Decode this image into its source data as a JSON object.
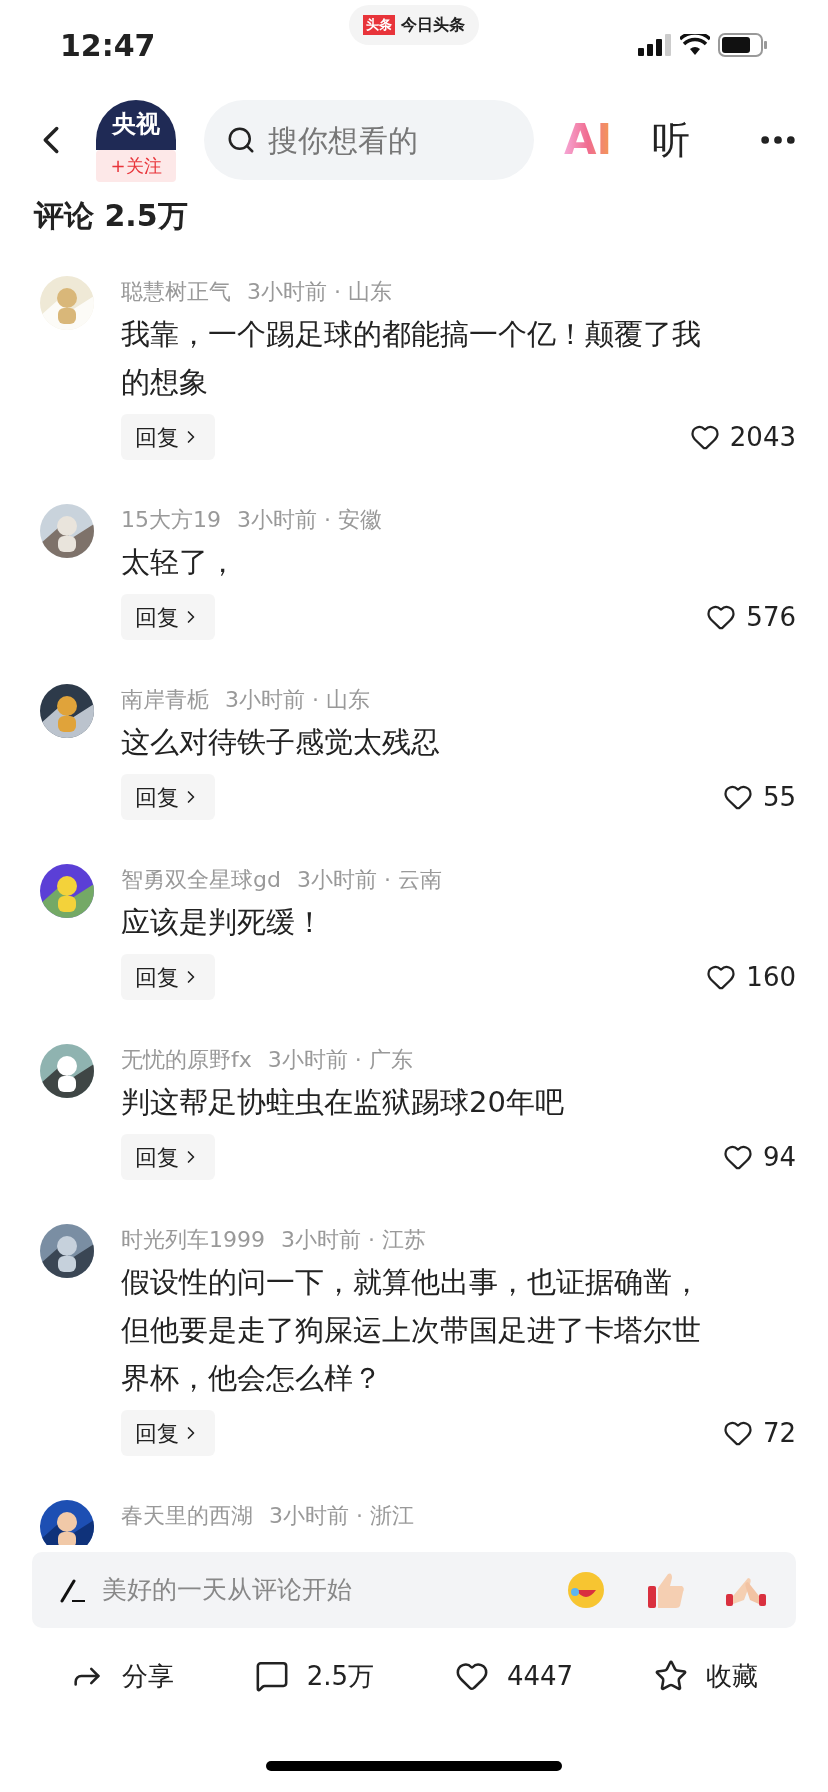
{
  "status_bar": {
    "time": "12:47",
    "app_badge": {
      "logo_text": "头条",
      "label": "今日头条"
    }
  },
  "header": {
    "channel": {
      "avatar_text": "央视",
      "follow_label": "+关注"
    },
    "search": {
      "placeholder": "搜你想看的"
    },
    "ai_label": "AI",
    "listen_label": "听"
  },
  "comments_title": "评论 2.5万",
  "comments": [
    {
      "user": "聪慧树正气",
      "meta": "3小时前 · 山东",
      "text": "我靠，一个踢足球的都能搞一个亿！颠覆了我的想象",
      "reply_label": "回复",
      "likes": "2043"
    },
    {
      "user": "15大方19",
      "meta": "3小时前 · 安徽",
      "text": "太轻了，",
      "reply_label": "回复",
      "likes": "576"
    },
    {
      "user": "南岸青栀",
      "meta": "3小时前 · 山东",
      "text": "这么对待铁子感觉太残忍",
      "reply_label": "回复",
      "likes": "55"
    },
    {
      "user": "智勇双全星球gd",
      "meta": "3小时前 · 云南",
      "text": "应该是判死缓！",
      "reply_label": "回复",
      "likes": "160"
    },
    {
      "user": "无忧的原野fx",
      "meta": "3小时前 · 广东",
      "text": "判这帮足协蛀虫在监狱踢球20年吧",
      "reply_label": "回复",
      "likes": "94"
    },
    {
      "user": "时光列车1999",
      "meta": "3小时前 · 江苏",
      "text": "假设性的问一下，就算他出事，也证据确凿，但他要是走了狗屎运上次带国足进了卡塔尔世界杯，他会怎么样？",
      "reply_label": "回复",
      "likes": "72"
    },
    {
      "user": "春天里的西湖",
      "meta": "3小时前 · 浙江"
    }
  ],
  "comment_input": {
    "placeholder": "美好的一天从评论开始"
  },
  "actions": [
    {
      "kind": "share",
      "label": "分享"
    },
    {
      "kind": "comment",
      "label": "2.5万"
    },
    {
      "kind": "like",
      "label": "4447"
    },
    {
      "kind": "favorite",
      "label": "收藏"
    }
  ]
}
